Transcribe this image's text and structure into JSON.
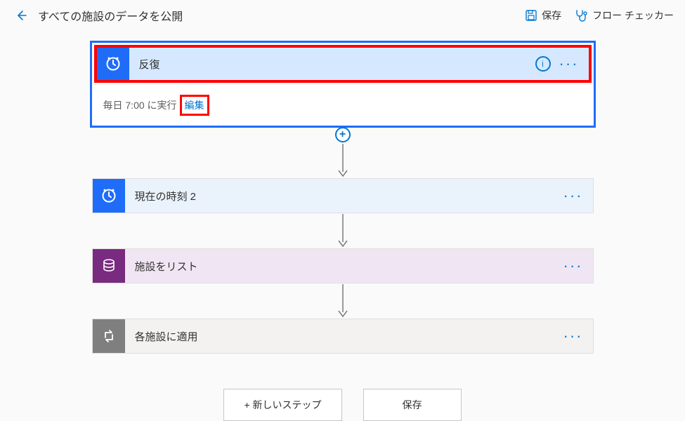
{
  "header": {
    "title": "すべての施設のデータを公開",
    "save_label": "保存",
    "checker_label": "フロー チェッカー"
  },
  "trigger": {
    "title": "反復",
    "schedule_text": "毎日 7:00 に実行",
    "edit_label": "編集"
  },
  "steps": [
    {
      "title": "現在の時刻 2"
    },
    {
      "title": "施設をリスト"
    },
    {
      "title": "各施設に適用"
    }
  ],
  "footer": {
    "new_step_label": "+ 新しいステップ",
    "save_label": "保存"
  }
}
